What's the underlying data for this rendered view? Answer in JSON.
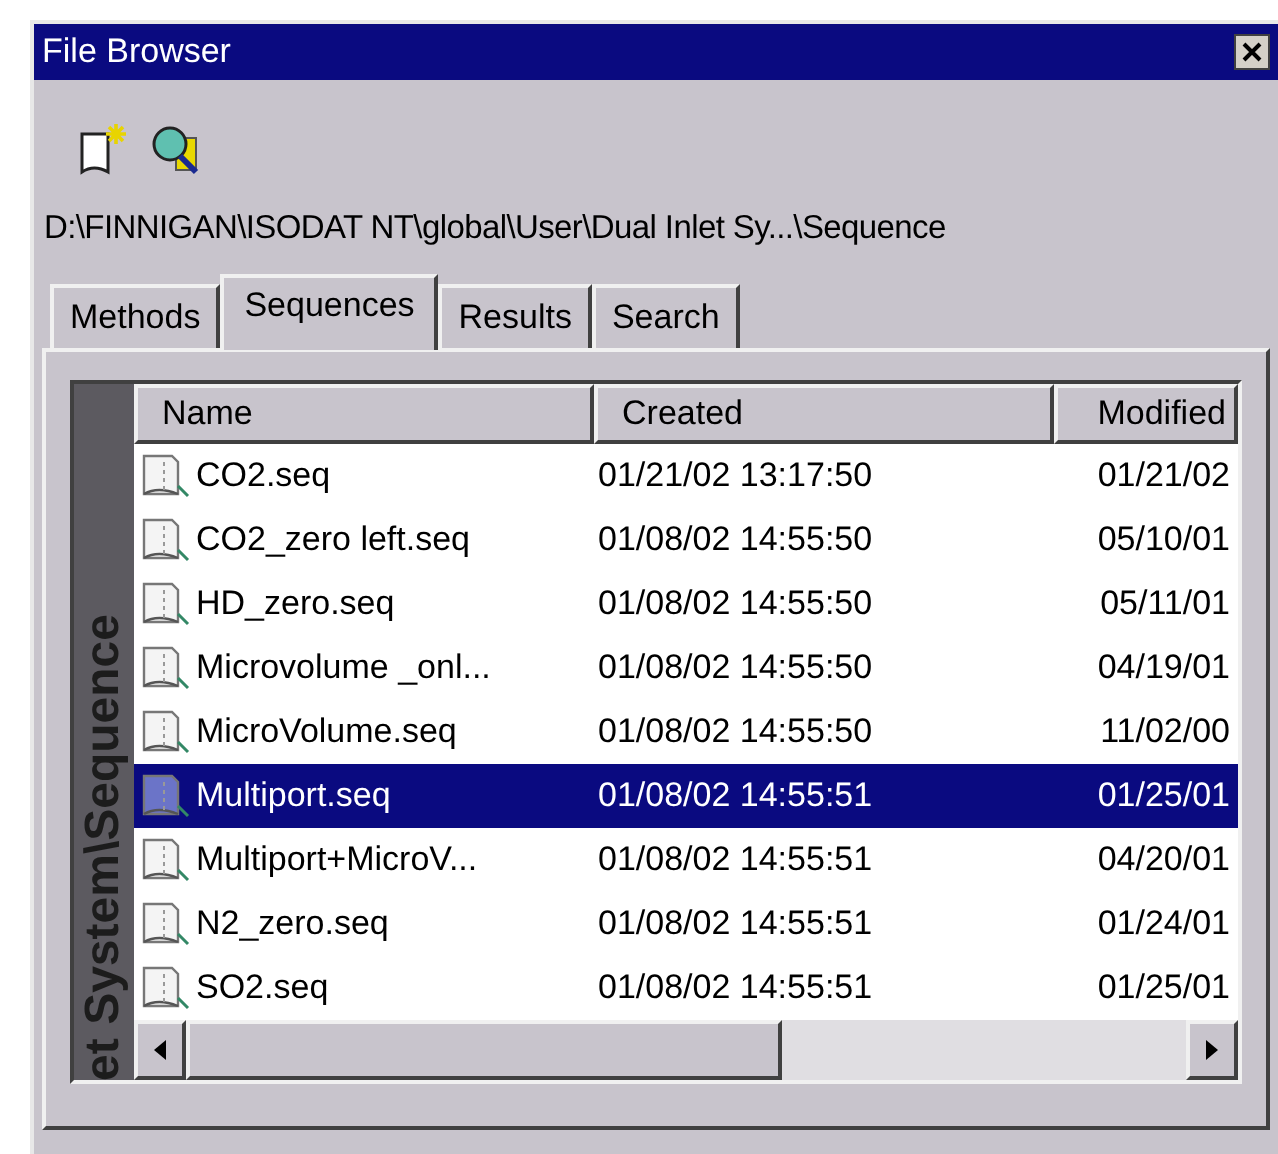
{
  "window": {
    "title": "File Browser"
  },
  "path": "D:\\FINNIGAN\\ISODAT NT\\global\\User\\Dual Inlet Sy...\\Sequence",
  "tabs": [
    {
      "label": "Methods",
      "selected": false
    },
    {
      "label": "Sequences",
      "selected": true
    },
    {
      "label": "Results",
      "selected": false
    },
    {
      "label": "Search",
      "selected": false
    }
  ],
  "side_label": "et System\\Sequence",
  "table": {
    "columns": [
      "Name",
      "Created",
      "Modified"
    ],
    "rows": [
      {
        "name": "CO2.seq",
        "created": "01/21/02 13:17:50",
        "modified": "01/21/02",
        "selected": false
      },
      {
        "name": "CO2_zero left.seq",
        "created": "01/08/02 14:55:50",
        "modified": "05/10/01",
        "selected": false
      },
      {
        "name": "HD_zero.seq",
        "created": "01/08/02 14:55:50",
        "modified": "05/11/01",
        "selected": false
      },
      {
        "name": "Microvolume _onl...",
        "created": "01/08/02 14:55:50",
        "modified": "04/19/01",
        "selected": false
      },
      {
        "name": "MicroVolume.seq",
        "created": "01/08/02 14:55:50",
        "modified": "11/02/00",
        "selected": false
      },
      {
        "name": "Multiport.seq",
        "created": "01/08/02 14:55:51",
        "modified": "01/25/01",
        "selected": true
      },
      {
        "name": "Multiport+MicroV...",
        "created": "01/08/02 14:55:51",
        "modified": "04/20/01",
        "selected": false
      },
      {
        "name": "N2_zero.seq",
        "created": "01/08/02 14:55:51",
        "modified": "01/24/01",
        "selected": false
      },
      {
        "name": "SO2.seq",
        "created": "01/08/02 14:55:51",
        "modified": "01/25/01",
        "selected": false
      }
    ]
  }
}
